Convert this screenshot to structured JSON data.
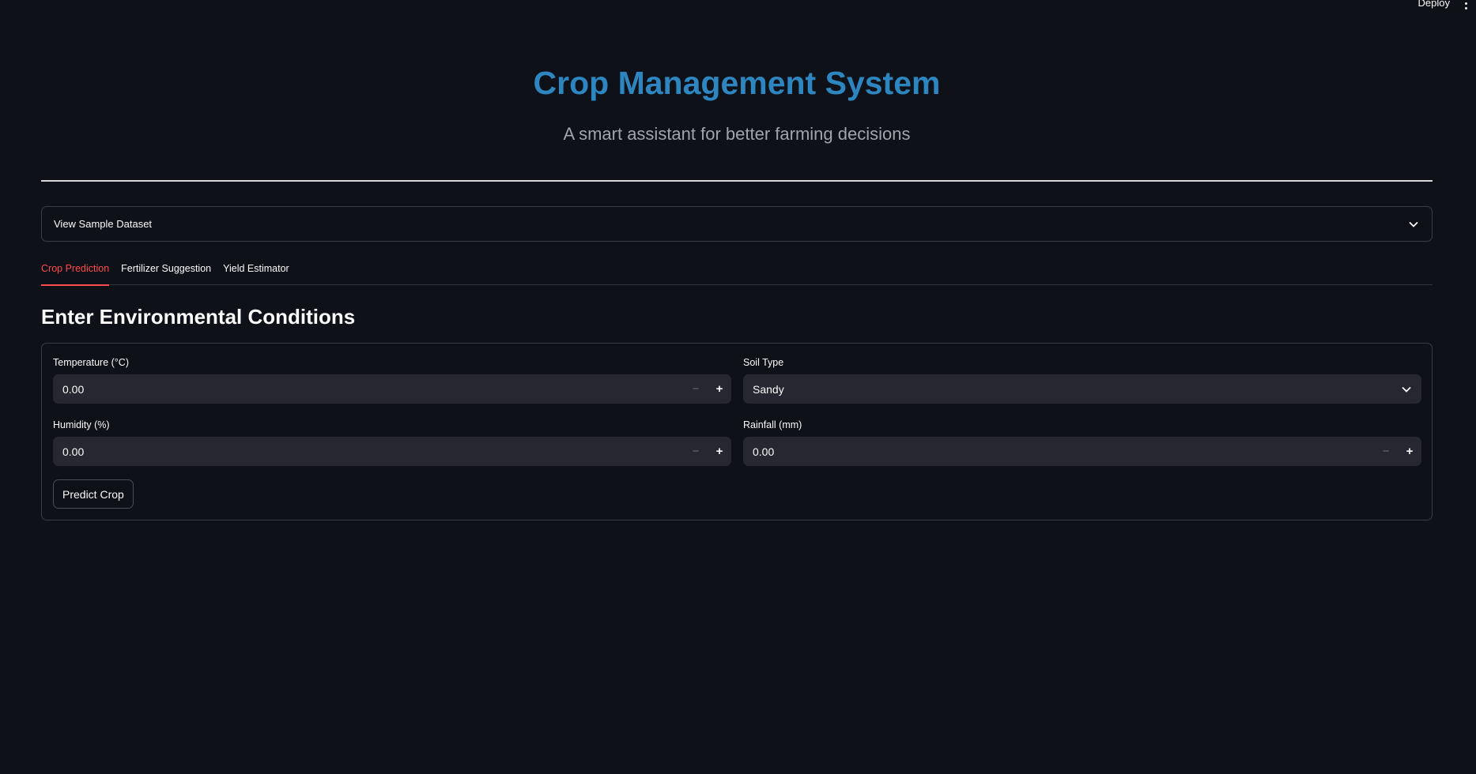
{
  "header": {
    "deploy_label": "Deploy"
  },
  "hero": {
    "title": "Crop Management System",
    "subtitle": "A smart assistant for better farming decisions",
    "title_color": "#2e86c1"
  },
  "expander": {
    "label": "View Sample Dataset",
    "icon": "chevron-down-icon"
  },
  "tabs": [
    {
      "label": "Crop Prediction",
      "active": true
    },
    {
      "label": "Fertilizer Suggestion",
      "active": false
    },
    {
      "label": "Yield Estimator",
      "active": false
    }
  ],
  "accent_color": "#ff4b4b",
  "section": {
    "heading": "Enter Environmental Conditions"
  },
  "form": {
    "temperature": {
      "label": "Temperature (°C)",
      "value": "0.00"
    },
    "soil_type": {
      "label": "Soil Type",
      "value": "Sandy"
    },
    "humidity": {
      "label": "Humidity (%)",
      "value": "0.00"
    },
    "rainfall": {
      "label": "Rainfall (mm)",
      "value": "0.00"
    },
    "stepper_minus": "−",
    "stepper_plus": "+",
    "submit_label": "Predict Crop"
  }
}
